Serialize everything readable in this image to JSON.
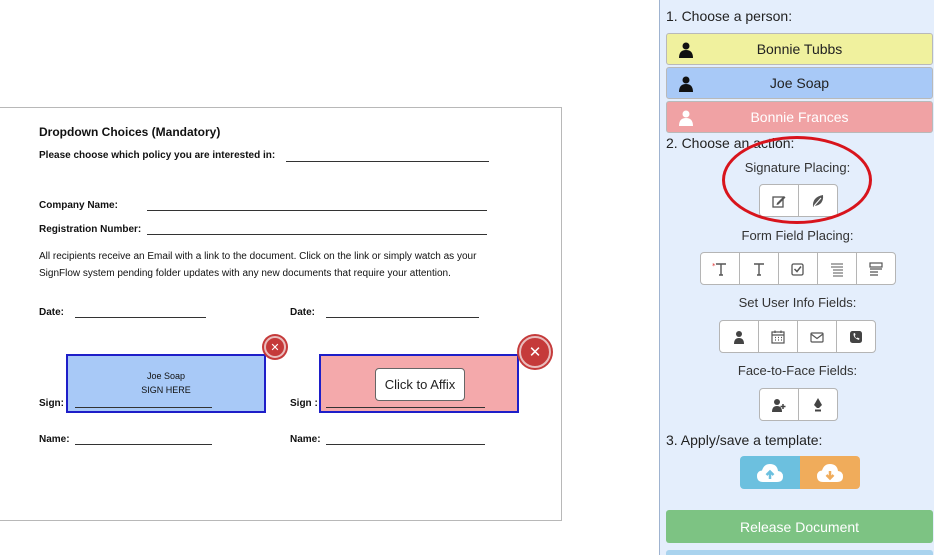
{
  "document": {
    "section_title": "Dropdown Choices (Mandatory)",
    "policy_prompt": "Please choose which policy you are interested in:",
    "company_label": "Company Name:",
    "registration_label": "Registration Number:",
    "paragraph": "All recipients receive an Email with a link to the document. Click on the link or simply watch as your SignFlow system pending folder updates with any new documents that require your attention.",
    "date_label_left": "Date:",
    "date_label_right": "Date:",
    "sign_label_left": "Sign:",
    "sign_label_right": "Sign :",
    "name_label_left": "Name:",
    "name_label_right": "Name:",
    "sig_box_left": {
      "name": "Joe Soap",
      "hint": "SIGN HERE",
      "color": "#a8c9f7"
    },
    "sig_box_right": {
      "button": "Click to Affix",
      "color": "#f4a9ab"
    }
  },
  "panel": {
    "step1": "1. Choose a person:",
    "people": [
      {
        "name": "Bonnie Tubbs",
        "color": "#f0f19e"
      },
      {
        "name": "Joe Soap",
        "color": "#a8c9f7"
      },
      {
        "name": "Bonnie Frances",
        "color": "#f0a2a4"
      }
    ],
    "step2": "2. Choose an action:",
    "signature_placing": "Signature Placing:",
    "form_field_placing": "Form Field Placing:",
    "set_user_info": "Set User Info Fields:",
    "face_to_face": "Face-to-Face Fields:",
    "step3": "3. Apply/save a template:",
    "release": "Release Document",
    "accent_release": "#7dc383",
    "highlight_color": "#d8141c"
  }
}
